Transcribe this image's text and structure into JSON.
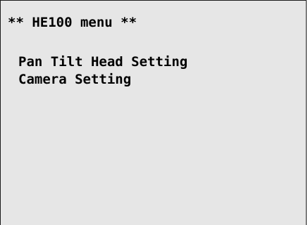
{
  "menu": {
    "title": "** HE100 menu **",
    "items": [
      {
        "label": "Pan Tilt Head Setting"
      },
      {
        "label": "Camera Setting"
      }
    ]
  },
  "colors": {
    "screen_background": "#e6e6e6",
    "text": "#000000",
    "border": "#1a1a1a"
  }
}
